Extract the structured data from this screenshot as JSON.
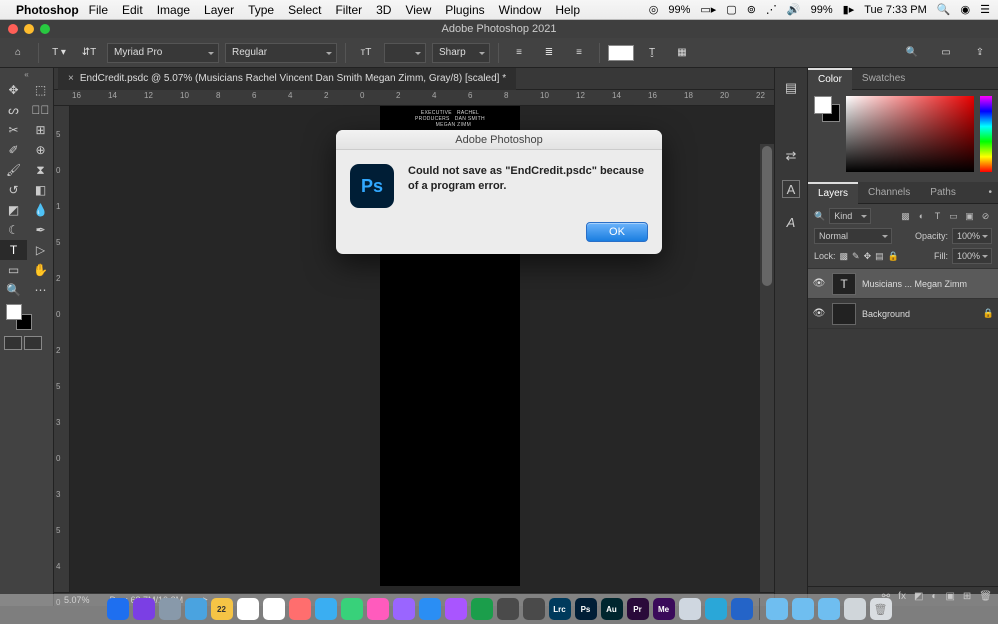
{
  "mac_menu": {
    "app_name": "Photoshop",
    "items": [
      "File",
      "Edit",
      "Image",
      "Layer",
      "Type",
      "Select",
      "Filter",
      "3D",
      "View",
      "Plugins",
      "Window",
      "Help"
    ],
    "status_cpu": "99%",
    "status_batt": "99%",
    "status_time": "Tue 7:33 PM"
  },
  "window": {
    "title": "Adobe Photoshop 2021"
  },
  "options_bar": {
    "font": "Myriad Pro",
    "weight": "Regular",
    "aa": "Sharp"
  },
  "document": {
    "tab_title": "EndCredit.psdc @ 5.07% (Musicians        Rachel Vincent        Dan Smith  Megan Zimm, Gray/8) [scaled] *",
    "zoom": "5.07%",
    "doc_size": "Doc: 68.7M/10.2M"
  },
  "ruler_h": [
    "16",
    "14",
    "12",
    "10",
    "8",
    "6",
    "4",
    "2",
    "0",
    "2",
    "4",
    "6",
    "8",
    "10",
    "12",
    "14",
    "16",
    "18",
    "20",
    "22"
  ],
  "ruler_v": [
    "5",
    "0",
    "1",
    "5",
    "2",
    "0",
    "2",
    "5",
    "3",
    "0",
    "3",
    "5",
    "4",
    "0"
  ],
  "dialog": {
    "title": "Adobe Photoshop",
    "message": "Could not save as \"EndCredit.psdc\" because of a program error.",
    "ok": "OK"
  },
  "panels": {
    "color": {
      "tabs": [
        "Color",
        "Swatches"
      ],
      "active": 0
    },
    "layers": {
      "tabs": [
        "Layers",
        "Channels",
        "Paths"
      ],
      "active": 0,
      "kind": "Kind",
      "blend": "Normal",
      "opacity_label": "Opacity:",
      "opacity": "100%",
      "lock_label": "Lock:",
      "fill_label": "Fill:",
      "fill": "100%",
      "items": [
        {
          "visible": true,
          "thumb": "T",
          "name": "Musicians   ...  Megan Zimm",
          "locked": false,
          "selected": true
        },
        {
          "visible": true,
          "thumb": "",
          "name": "Background",
          "locked": true,
          "selected": false
        }
      ]
    }
  },
  "dock_apps": [
    {
      "c": "#1e6ff0"
    },
    {
      "c": "#7b3fe4"
    },
    {
      "c": "#8899aa"
    },
    {
      "c": "#4aa3e0"
    },
    {
      "c": "#f6c445",
      "t": "22"
    },
    {
      "c": "#ffffff"
    },
    {
      "c": "#ffffff"
    },
    {
      "c": "#ff6e6e"
    },
    {
      "c": "#3aaef2"
    },
    {
      "c": "#38d17a"
    },
    {
      "c": "#ff5bbd"
    },
    {
      "c": "#9a65ff"
    },
    {
      "c": "#2a8ef4"
    },
    {
      "c": "#a955ff"
    },
    {
      "c": "#1b9e4b"
    },
    {
      "c": "#4a4a4a"
    },
    {
      "c": "#4a4a4a"
    },
    {
      "c": "#003a5c",
      "t": "Lrc"
    },
    {
      "c": "#001e36",
      "t": "Ps"
    },
    {
      "c": "#00262e",
      "t": "Au"
    },
    {
      "c": "#2a0a3a",
      "t": "Pr"
    },
    {
      "c": "#3a0a5a",
      "t": "Me"
    },
    {
      "c": "#cfd7e0"
    },
    {
      "c": "#2aa7d8"
    },
    {
      "c": "#2464c8"
    }
  ]
}
